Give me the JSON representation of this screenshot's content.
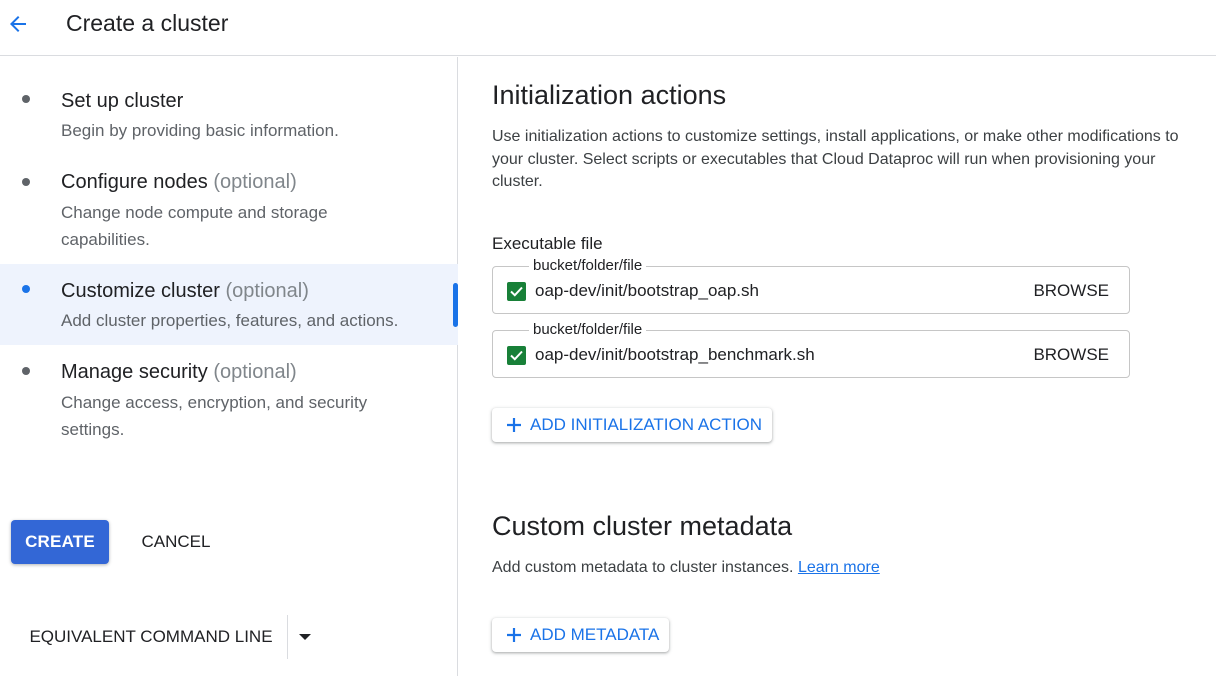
{
  "header": {
    "back_icon": "arrow-back-icon",
    "title": "Create a cluster"
  },
  "steps": [
    {
      "title": "Set up cluster",
      "optional": "",
      "desc": "Begin by providing basic information."
    },
    {
      "title": "Configure nodes",
      "optional": "(optional)",
      "desc": "Change node compute and storage capabilities."
    },
    {
      "title": "Customize cluster",
      "optional": "(optional)",
      "desc": "Add cluster properties, features, and actions."
    },
    {
      "title": "Manage security",
      "optional": "(optional)",
      "desc": "Change access, encryption, and security settings."
    }
  ],
  "actions": {
    "create": "CREATE",
    "cancel": "CANCEL",
    "equivalent": "EQUIVALENT COMMAND LINE"
  },
  "init": {
    "title": "Initialization actions",
    "description": "Use initialization actions to customize settings, install applications, or make other modifications to your cluster. Select scripts or executables that Cloud Dataproc will run when provisioning your cluster.",
    "field_label": "Executable file",
    "files": [
      {
        "label": "bucket/folder/file",
        "value": "oap-dev/init/bootstrap_oap.sh",
        "checked": true,
        "browse": "BROWSE"
      },
      {
        "label": "bucket/folder/file",
        "value": "oap-dev/init/bootstrap_benchmark.sh",
        "checked": true,
        "browse": "BROWSE"
      }
    ],
    "add_button": "ADD INITIALIZATION ACTION"
  },
  "metadata": {
    "title": "Custom cluster metadata",
    "description": "Add custom metadata to cluster instances.",
    "learn_more": "Learn more",
    "add_button": "ADD METADATA"
  },
  "colors": {
    "accent": "#1a73e8",
    "primary_button": "#3367d6",
    "checkbox": "#188038",
    "active_step_bg": "#eef3fd"
  }
}
